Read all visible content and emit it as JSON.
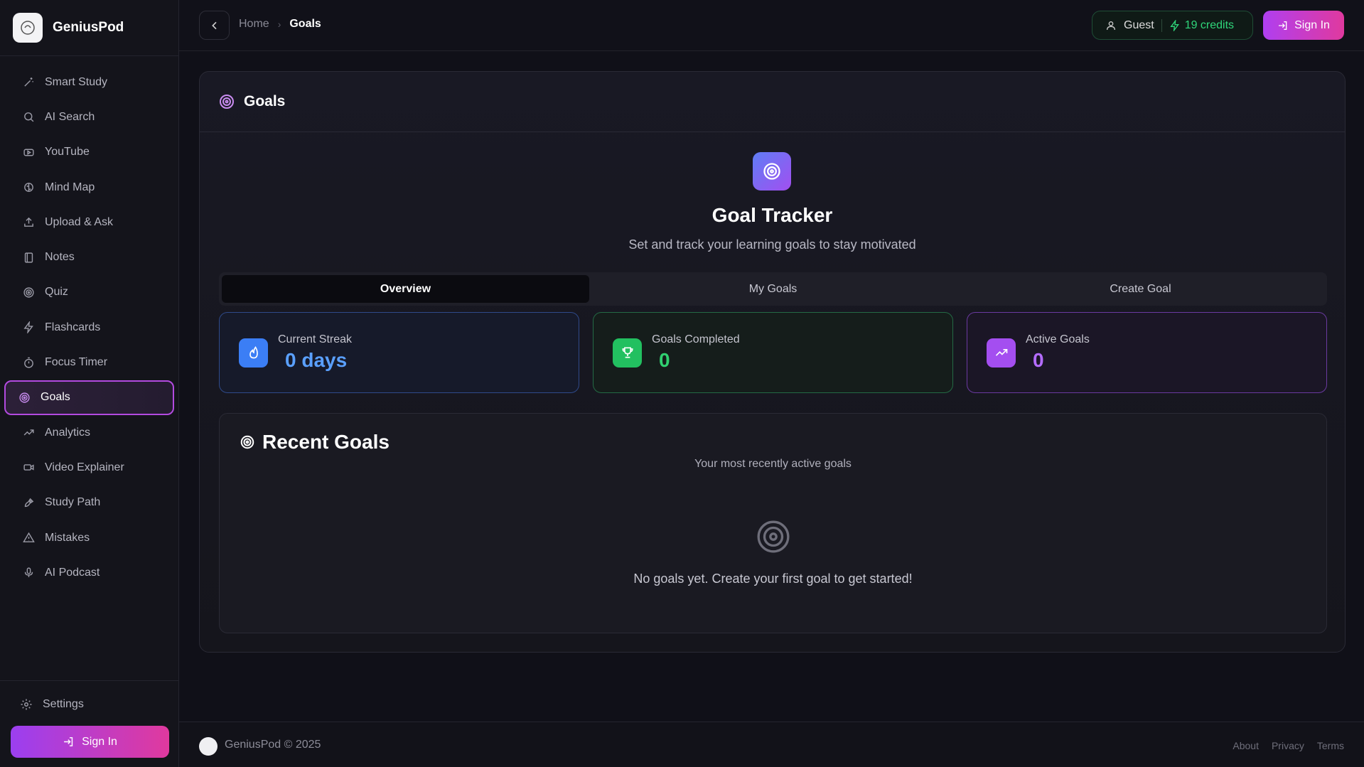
{
  "brand": {
    "name": "GeniusPod"
  },
  "sidebar": {
    "items": [
      {
        "label": "Smart Study",
        "icon": "wand-icon"
      },
      {
        "label": "AI Search",
        "icon": "search-icon"
      },
      {
        "label": "YouTube",
        "icon": "youtube-icon"
      },
      {
        "label": "Mind Map",
        "icon": "brain-icon"
      },
      {
        "label": "Upload & Ask",
        "icon": "upload-icon"
      },
      {
        "label": "Notes",
        "icon": "notebook-icon"
      },
      {
        "label": "Quiz",
        "icon": "target-icon"
      },
      {
        "label": "Flashcards",
        "icon": "bolt-icon"
      },
      {
        "label": "Focus Timer",
        "icon": "timer-icon"
      },
      {
        "label": "Goals",
        "icon": "target-icon",
        "active": true
      },
      {
        "label": "Analytics",
        "icon": "trend-icon"
      },
      {
        "label": "Video Explainer",
        "icon": "video-icon"
      },
      {
        "label": "Study Path",
        "icon": "rocket-icon"
      },
      {
        "label": "Mistakes",
        "icon": "warning-icon"
      },
      {
        "label": "AI Podcast",
        "icon": "mic-icon"
      }
    ],
    "settings_label": "Settings",
    "signin_label": "Sign In"
  },
  "topbar": {
    "breadcrumb": {
      "home": "Home",
      "current": "Goals"
    },
    "guest_label": "Guest",
    "credits_label": "19 credits",
    "signin_label": "Sign In"
  },
  "main": {
    "card_title": "Goals",
    "hero_title": "Goal Tracker",
    "hero_subtitle": "Set and track your learning goals to stay motivated",
    "tabs": [
      {
        "label": "Overview",
        "active": true
      },
      {
        "label": "My Goals"
      },
      {
        "label": "Create Goal"
      }
    ],
    "stats": [
      {
        "label": "Current Streak",
        "value": "0 days",
        "color": "#3b7ef5"
      },
      {
        "label": "Goals Completed",
        "value": "0",
        "color": "#22c060"
      },
      {
        "label": "Active Goals",
        "value": "0",
        "color": "#a44ef0"
      }
    ],
    "recent": {
      "title": "Recent Goals",
      "subtitle": "Your most recently active goals",
      "empty_text": "No goals yet. Create your first goal to get started!"
    }
  },
  "footer": {
    "copyright": "GeniusPod © 2025",
    "links": [
      "About",
      "Privacy",
      "Terms"
    ]
  },
  "colors": {
    "accent": "#b34ae0",
    "credits": "#2fd67a"
  }
}
